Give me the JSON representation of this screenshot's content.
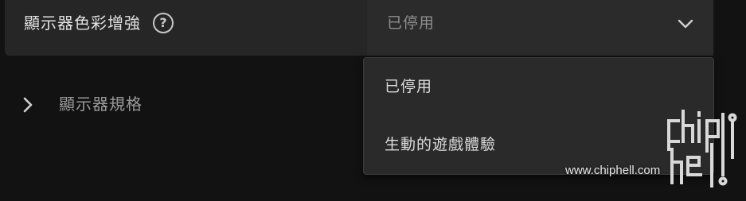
{
  "setting": {
    "label": "顯示器色彩增強",
    "help_symbol": "?",
    "selected_value": "已停用"
  },
  "expand_row": {
    "label": "顯示器規格"
  },
  "dropdown": {
    "options": [
      {
        "label": "已停用"
      },
      {
        "label": "生動的遊戲體驗"
      }
    ]
  },
  "watermark": {
    "url": "www.chiphell.com",
    "logo_text": "chiphell"
  },
  "icons": {
    "help": "help-icon",
    "dropdown": "chevron-down-icon",
    "expand": "chevron-right-icon"
  },
  "colors": {
    "background": "#121212",
    "card": "#262626",
    "menu": "#2a2a2a",
    "text_primary": "#e2e2e2",
    "text_muted": "#8f8f8f"
  }
}
